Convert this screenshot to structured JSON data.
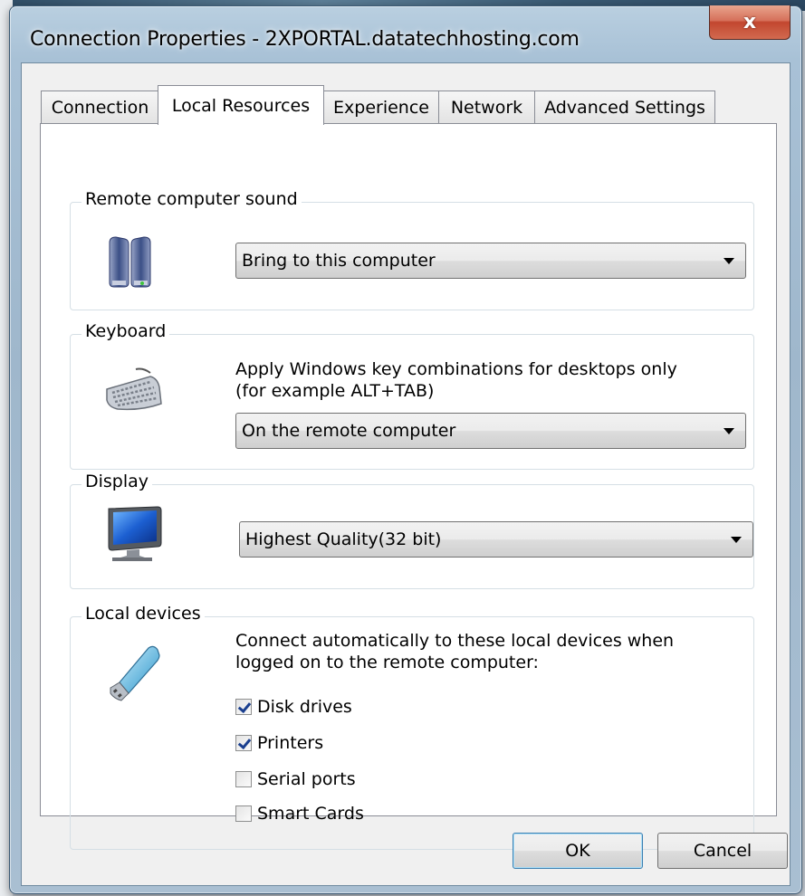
{
  "window": {
    "title": "Connection Properties - 2XPORTAL.datatechhosting.com",
    "close_glyph": "x"
  },
  "tabs": [
    {
      "label": "Connection"
    },
    {
      "label": "Local Resources"
    },
    {
      "label": "Experience"
    },
    {
      "label": "Network"
    },
    {
      "label": "Advanced Settings"
    }
  ],
  "active_tab": "Local Resources",
  "sound": {
    "legend": "Remote computer sound",
    "icon": "speakers-icon",
    "selected": "Bring to this computer"
  },
  "keyboard": {
    "legend": "Keyboard",
    "icon": "keyboard-icon",
    "description_line1": "Apply Windows key combinations for desktops only",
    "description_line2": "(for example ALT+TAB)",
    "selected": "On the remote computer"
  },
  "display": {
    "legend": "Display",
    "icon": "monitor-icon",
    "selected": "Highest Quality(32 bit)"
  },
  "devices": {
    "legend": "Local devices",
    "icon": "usb-drive-icon",
    "description_line1": "Connect automatically to these local devices when",
    "description_line2": "logged on to the remote computer:",
    "items": [
      {
        "label": "Disk drives",
        "checked": true
      },
      {
        "label": "Printers",
        "checked": true
      },
      {
        "label": "Serial ports",
        "checked": false
      },
      {
        "label": "Smart Cards",
        "checked": false
      }
    ]
  },
  "buttons": {
    "ok": "OK",
    "cancel": "Cancel"
  },
  "colors": {
    "check_mark": "#1a3f8f",
    "close_button": "#c2462f",
    "frame": "#a8c1d6"
  }
}
